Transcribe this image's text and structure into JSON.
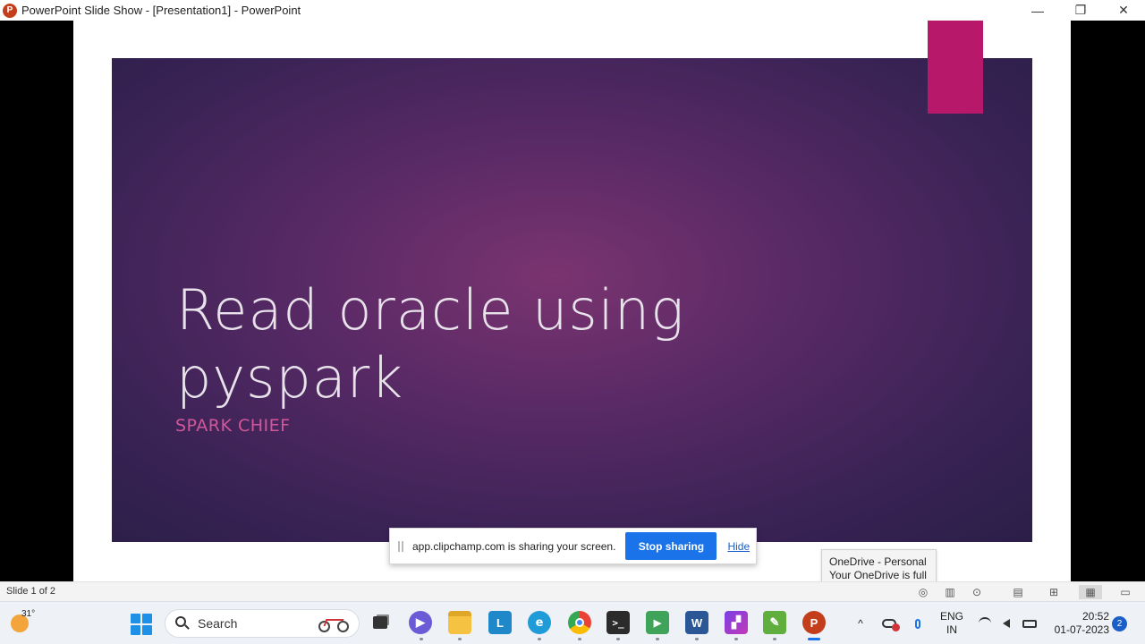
{
  "window": {
    "title": "PowerPoint Slide Show - [Presentation1] - PowerPoint",
    "app_icon_letter": "P",
    "controls": {
      "minimize": "—",
      "restore": "❐",
      "close": "✕"
    }
  },
  "slide": {
    "title_line1": "Read oracle using",
    "title_line2": "pyspark",
    "subtitle": "SPARK CHIEF",
    "accent_color": "#b8186a",
    "background_color": "#5a2a66"
  },
  "share_bar": {
    "message": "app.clipchamp.com is sharing your screen.",
    "stop_label": "Stop sharing",
    "hide_label": "Hide"
  },
  "tooltip": {
    "line1": "OneDrive - Personal",
    "line2": "Your OneDrive is full"
  },
  "statusbar": {
    "slide_count": "Slide 1 of 2",
    "icons": [
      "accessibility-icon",
      "notes-icon",
      "slideshow-icon",
      "reading-view-icon",
      "slide-sorter-icon",
      "normal-view-icon",
      "presenter-icon"
    ]
  },
  "taskbar": {
    "weather_temp": "31°",
    "search_placeholder": "Search",
    "apps": [
      {
        "name": "task-view",
        "glyph": "▣"
      },
      {
        "name": "teams-chat",
        "glyph": "▶"
      },
      {
        "name": "file-explorer",
        "glyph": ""
      },
      {
        "name": "app-l",
        "glyph": "L"
      },
      {
        "name": "edge",
        "glyph": "e"
      },
      {
        "name": "chrome",
        "glyph": "◎"
      },
      {
        "name": "terminal",
        "glyph": ">_"
      },
      {
        "name": "app-media",
        "glyph": "▶"
      },
      {
        "name": "word",
        "glyph": "W"
      },
      {
        "name": "clipchamp",
        "glyph": "▞"
      },
      {
        "name": "app-green",
        "glyph": "✎"
      },
      {
        "name": "powerpoint",
        "glyph": "P"
      }
    ],
    "tray": {
      "chevron": "^",
      "lang_line1": "ENG",
      "lang_line2": "IN",
      "time": "20:52",
      "date": "01-07-2023",
      "notification_count": "2"
    }
  }
}
